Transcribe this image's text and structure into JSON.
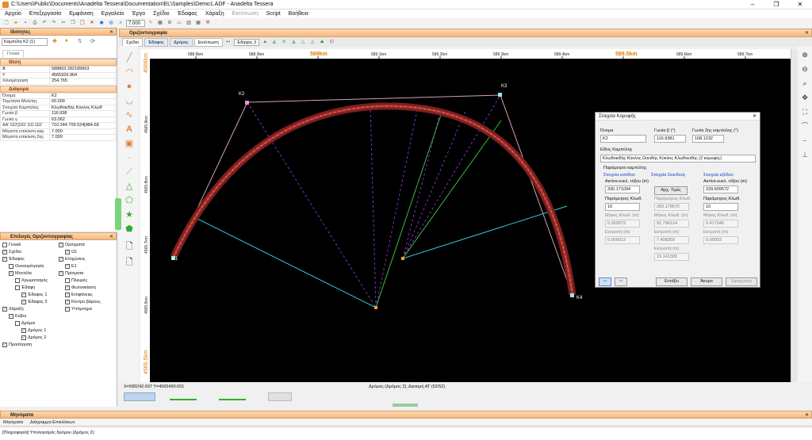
{
  "window": {
    "title": "C:\\Users\\Public\\Documents\\Anadelta Tessera\\Documentation\\EL\\Samples\\Demo1.ADF - Anadelta Tessera"
  },
  "menu": [
    "Αρχείο",
    "Επεξεργασία",
    "Εμφάνιση",
    "Εργαλεία",
    "Έργο",
    "Σχέδιο",
    "Έδαφος",
    "Χάραξη",
    "Εκτύπωση",
    "Script",
    "Βοήθεια"
  ],
  "toolbar": {
    "zoom_value": "7.000"
  },
  "props": {
    "title": "Ιδιότητες",
    "object": "Καμπύλη Κ2 (1)",
    "tab": "Γενικά",
    "sections": {
      "position": "Θέση",
      "misc": "Διάφορα"
    },
    "position_rows": [
      {
        "k": "X",
        "v": "588863.282189663"
      },
      {
        "k": "Y",
        "v": "4565926.964"
      },
      {
        "k": "Χιλιομέτρηση",
        "v": "254.765"
      }
    ],
    "misc_rows": [
      {
        "k": "Όνομα",
        "v": "Κ2"
      },
      {
        "k": "Ταχύτητα Μελέτης",
        "v": "60.000"
      },
      {
        "k": "Στοιχεία Καμπύλης",
        "v": "Κλωθοειδής Κύκλος Κλωθ"
      },
      {
        "k": "Γωνία β",
        "v": "116.938"
      },
      {
        "k": "Γωνία γ",
        "v": "63.062"
      },
      {
        "k": "ΑΑ' ΩΩ'[ΩΩ' ΩΩ ΩΩ'",
        "v": "710.244 709.524[484.68"
      },
      {
        "k": "Μέγιστη επίκλιση καμ",
        "v": "7.000"
      },
      {
        "k": "Μέγιστη επίκλιση 2ης",
        "v": "7.000"
      }
    ]
  },
  "layers": {
    "title": "Επιλογές Οριζοντιογραφίας",
    "col1": [
      {
        "t": "Γενικά",
        "c": false,
        "d": 0
      },
      {
        "t": "Σχέδιο",
        "c": true,
        "d": 0
      },
      {
        "t": "Έδαφος",
        "c": true,
        "d": 0
      },
      {
        "t": "Ουκουμέτρηση",
        "c": false,
        "d": 1
      },
      {
        "t": "Μοντέλα",
        "c": true,
        "d": 1
      },
      {
        "t": "Χρωματισμός",
        "c": false,
        "d": 2
      },
      {
        "t": "Έδάφη",
        "c": false,
        "d": 2
      },
      {
        "t": "Έδαφος 1",
        "c": true,
        "d": 3
      },
      {
        "t": "Έδαφος 3",
        "c": true,
        "d": 3
      },
      {
        "t": "Χάραξη",
        "c": true,
        "d": 0
      },
      {
        "t": "Κύβοι",
        "c": true,
        "d": 1
      },
      {
        "t": "Δρόμοι",
        "c": false,
        "d": 2
      },
      {
        "t": "Δρόμος 1",
        "c": true,
        "d": 3
      },
      {
        "t": "Δρόμος 2",
        "c": true,
        "d": 3
      },
      {
        "t": "Προσέγγιση",
        "c": true,
        "d": 0
      }
    ],
    "col2": [
      {
        "t": "Ορόγματα",
        "c": true,
        "d": 0
      },
      {
        "t": "Ω1",
        "c": true,
        "d": 1
      },
      {
        "t": "Επιχώσεις",
        "c": true,
        "d": 0
      },
      {
        "t": "Ε1",
        "c": true,
        "d": 1
      },
      {
        "t": "Πρίσματα",
        "c": true,
        "d": 0
      },
      {
        "t": "Πλευρές",
        "c": false,
        "d": 1
      },
      {
        "t": "Φωτοσκίαση",
        "c": true,
        "d": 1
      },
      {
        "t": "Επιφάνειες",
        "c": true,
        "d": 1
      },
      {
        "t": "Κέντρο βάρους",
        "c": true,
        "d": 1
      },
      {
        "t": "Υπόμνημα",
        "c": true,
        "d": 1
      }
    ]
  },
  "plan": {
    "tab": "Οριζοντιογραφία",
    "view_tabs": [
      "Σχέδιο",
      "Έδαφος",
      "Δρόμος",
      "Εκτύπωση"
    ],
    "ground_select": "Έδαφος 3",
    "ruler": [
      "588.8km",
      "588.9km",
      "589km",
      "589.1km",
      "589.2km",
      "589.3km",
      "589.4km",
      "589.5km",
      "589.6km",
      "589.7km"
    ],
    "vruler": [
      "4566km",
      "4565.9km",
      "4565.8km",
      "4565.7km",
      "4565.6km",
      "4565.5km"
    ],
    "points": [
      "Κ1",
      "Κ2",
      "Κ3",
      "Κ4"
    ]
  },
  "status": {
    "coords": "X=589242.697 Y=4565490.651",
    "info": "Δρόμος (Δρόμος 2), Διατομή ΑΤ (52/52)"
  },
  "messages": {
    "title": "Μηνύματα",
    "tabs": [
      "Μηνύματα",
      "Διάγραμμα Επικλίσεων"
    ],
    "line": "[Πληροφορία] Υπολογισμός δρόμου (Δρόμος 2):"
  },
  "dialog": {
    "title": "Στοιχεία Κορυφής",
    "name_label": "Όνομα",
    "name": "Κ2",
    "beta_label": "Γωνία β (°)",
    "beta": "116.9381",
    "gamma_label": "Γωνία 2ης καμπύλης (°)",
    "gamma": "108.1232",
    "type_label": "Είδος Καμπύλης",
    "type": "Κλωθοειδής Κύκλος Ωοειδής Κύκλος Κλωθοειδής (2 κορυφές)",
    "params_label": "Παράμετροι καμπύλης",
    "col_in": "Στοιχεία εισόδου",
    "col_mid": "Στοιχεία Ωοειδούς",
    "col_out": "Στοιχεία εξόδου",
    "radius_label": "Ακτίνα κυκλ. τόξου (m)",
    "radius_in": "330.171094",
    "radius_out": "239.609572",
    "btn_initial": "Αρχ. Τιμές",
    "param_label": "Παράμετρος Κλωθ.",
    "param_in": "10",
    "param_mid": "283.179572",
    "param_out": "10",
    "length_label": "Μήκος Κλωθ. (m)",
    "length_in": "0.302873",
    "length_mid": "91.796124",
    "length_out": "0.417346",
    "shift_label": "Εκτροπή (m)",
    "shift_in": "0.000012",
    "shift_mid": "7.408359",
    "shift_out": "0.00003",
    "shift2": "19.141309",
    "buttons": {
      "ok": "Εντάξει",
      "cancel": "Άκυρο",
      "apply": "Εφαρμογή"
    }
  }
}
